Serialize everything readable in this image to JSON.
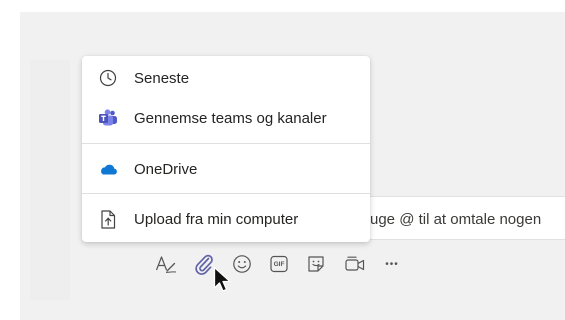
{
  "compose": {
    "visible_text": "uge @ til at omtale nogen"
  },
  "attach_menu": {
    "items": [
      {
        "label": "Seneste",
        "icon": "clock-icon"
      },
      {
        "label": "Gennemse teams og kanaler",
        "icon": "teams-icon"
      },
      {
        "label": "OneDrive",
        "icon": "onedrive-icon"
      },
      {
        "label": "Upload fra min computer",
        "icon": "upload-icon"
      }
    ]
  },
  "toolbar": {
    "buttons": [
      "format-icon",
      "attach-icon",
      "emoji-icon",
      "gif-icon",
      "sticker-icon",
      "meet-now-icon",
      "more-options-icon"
    ],
    "gif_label": "GIF",
    "more_label": "•••"
  },
  "colors": {
    "accent": "#6264a7",
    "onedrive": "#0f78d4",
    "backdrop": "#f1f1f1"
  }
}
